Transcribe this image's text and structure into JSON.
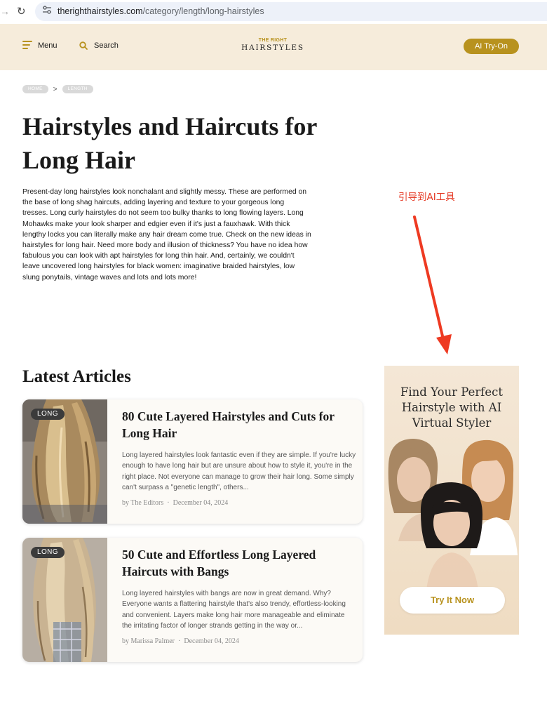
{
  "browser": {
    "url_host": "therighthairstyles.com",
    "url_path": "/category/length/long-hairstyles"
  },
  "header": {
    "menu_label": "Menu",
    "search_label": "Search",
    "logo_top": "THE RIGHT",
    "logo_main": "HAIRSTYLES",
    "tryon_label": "AI Try-On",
    "accent_color": "#b8921e",
    "background_color": "#f6ecdb"
  },
  "breadcrumb": {
    "home": "HOME",
    "separator": ">",
    "current": "LENGTH"
  },
  "page": {
    "title": "Hairstyles and Haircuts for Long Hair",
    "intro": "Present-day long hairstyles look nonchalant and slightly messy. These are performed on the base of long shag haircuts, adding layering and texture to your gorgeous long tresses. Long curly hairstyles do not seem too bulky thanks to long flowing layers. Long Mohawks make your look sharper and edgier even if it's just a fauxhawk. With thick lengthy locks you can literally make any hair dream come true. Check on the new ideas in hairstyles for long hair. Need more body and illusion of thickness? You have no idea how fabulous you can look with apt hairstyles for long thin hair. And, certainly, we couldn't leave uncovered long hairstyles for black women: imaginative braided hairstyles, low slung ponytails, vintage waves and lots and lots more!"
  },
  "annotation": {
    "text": "引导到AI工具",
    "color": "#e53a25"
  },
  "latest": {
    "heading": "Latest Articles",
    "articles": [
      {
        "tag": "LONG",
        "title": "80 Cute Layered Hairstyles and Cuts for Long Hair",
        "excerpt": "Long layered hairstyles look fantastic even if they are simple. If you're lucky enough to have long hair but are unsure about how to style it, you're in the right place. Not everyone can manage to grow their hair long. Some simply can't surpass a \"genetic length\", others...",
        "author": "by The Editors",
        "date": "December 04, 2024"
      },
      {
        "tag": "LONG",
        "title": "50 Cute and Effortless Long Layered Haircuts with Bangs",
        "excerpt": "Long layered hairstyles with bangs are now in great demand. Why? Everyone wants a flattering hairstyle that's also trendy, effortless-looking and convenient. Layers make long hair more manageable and eliminate the irritating factor of longer strands getting in the way or...",
        "author": "by Marissa Palmer",
        "date": "December 04, 2024"
      }
    ],
    "meta_separator": "·"
  },
  "ad": {
    "title_line1": "Find Your Perfect",
    "title_line2": "Hairstyle with AI",
    "title_line3": "Virtual Styler",
    "button_label": "Try It Now"
  }
}
